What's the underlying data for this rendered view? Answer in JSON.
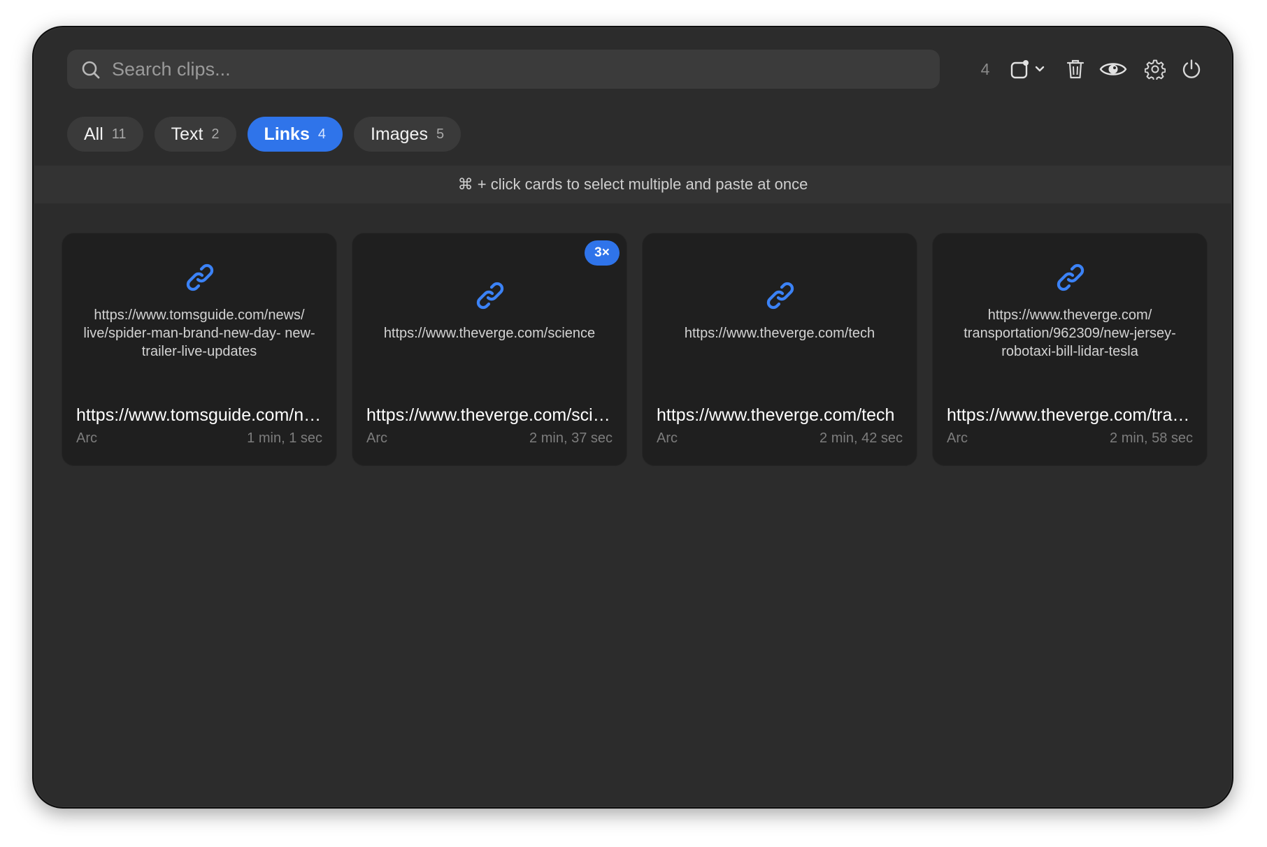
{
  "search": {
    "placeholder": "Search clips...",
    "value": ""
  },
  "toolbar": {
    "selected_count": "4",
    "icons": [
      "new-window-icon",
      "chevron-down-icon",
      "trash-icon",
      "eye-icon",
      "gear-icon",
      "power-icon"
    ]
  },
  "tabs": [
    {
      "label": "All",
      "count": "11",
      "active": false
    },
    {
      "label": "Text",
      "count": "2",
      "active": false
    },
    {
      "label": "Links",
      "count": "4",
      "active": true
    },
    {
      "label": "Images",
      "count": "5",
      "active": false
    }
  ],
  "hint": "⌘ + click cards to select multiple and paste at once",
  "cards": [
    {
      "preview": "https://www.tomsguide.com/news/ live/spider-man-brand-new-day- new-trailer-live-updates",
      "title": "https://www.tomsguide.com/news/live/spider-man-brand-new-day-new-trailer-live-updates",
      "source": "Arc",
      "age": "1 min, 1 sec",
      "badge": ""
    },
    {
      "preview": "https://www.theverge.com/science",
      "title": "https://www.theverge.com/science",
      "source": "Arc",
      "age": "2 min, 37 sec",
      "badge": "3×"
    },
    {
      "preview": "https://www.theverge.com/tech",
      "title": "https://www.theverge.com/tech",
      "source": "Arc",
      "age": "2 min, 42 sec",
      "badge": ""
    },
    {
      "preview": "https://www.theverge.com/ transportation/962309/new-jersey- robotaxi-bill-lidar-tesla",
      "title": "https://www.theverge.com/transportation/962309/new-jersey-robotaxi-bill-lidar-tesla",
      "source": "Arc",
      "age": "2 min, 58 sec",
      "badge": ""
    }
  ],
  "colors": {
    "window_bg": "#2c2c2c",
    "card_bg": "#1f1f1f",
    "accent": "#2f74ea",
    "link_icon": "#3b82f6"
  }
}
